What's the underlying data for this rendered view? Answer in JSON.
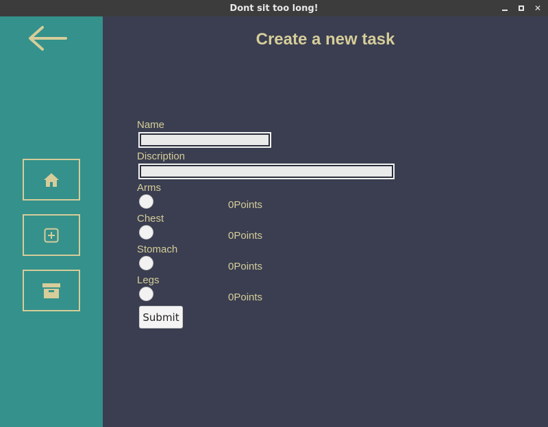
{
  "window": {
    "title": "Dont sit too long!",
    "controls": {
      "minimize_icon": "minimize-icon",
      "maximize_icon": "maximize-icon",
      "close_glyph": "✕"
    }
  },
  "sidebar": {
    "back_icon": "arrow-left-icon",
    "nav": [
      {
        "icon": "home-icon"
      },
      {
        "icon": "plus-square-icon"
      },
      {
        "icon": "archive-box-icon"
      }
    ]
  },
  "colors": {
    "accent": "#d6cd9a",
    "sidebar": "#35918b",
    "background": "#3a3e50"
  },
  "main": {
    "title": "Create a new task",
    "form": {
      "name_label": "Name",
      "name_value": "",
      "description_label": "Discription",
      "description_value": "",
      "body_parts": [
        {
          "label": "Arms",
          "points_value": "0",
          "points_unit": "Points"
        },
        {
          "label": "Chest",
          "points_value": "0",
          "points_unit": "Points"
        },
        {
          "label": "Stomach",
          "points_value": "0",
          "points_unit": "Points"
        },
        {
          "label": "Legs",
          "points_value": "0",
          "points_unit": "Points"
        }
      ],
      "submit_label": "Submit"
    }
  }
}
